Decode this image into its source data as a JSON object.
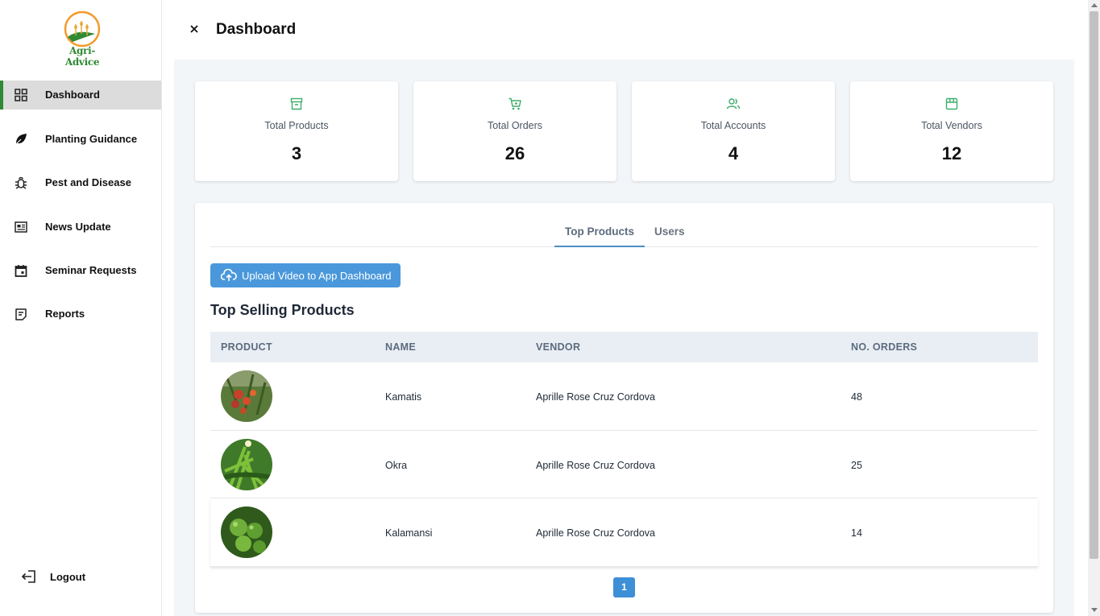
{
  "brand": {
    "name": "Agri-Advice"
  },
  "sidebar": {
    "items": [
      {
        "label": "Dashboard",
        "icon": "grid-icon"
      },
      {
        "label": "Planting Guidance",
        "icon": "leaf-icon"
      },
      {
        "label": "Pest and Disease",
        "icon": "bug-icon"
      },
      {
        "label": "News Update",
        "icon": "newspaper-icon"
      },
      {
        "label": "Seminar Requests",
        "icon": "calendar-icon"
      },
      {
        "label": "Reports",
        "icon": "report-icon"
      }
    ],
    "logout_label": "Logout"
  },
  "header": {
    "title": "Dashboard"
  },
  "stats": [
    {
      "label": "Total Products",
      "value": "3",
      "icon": "archive-icon"
    },
    {
      "label": "Total Orders",
      "value": "26",
      "icon": "cart-icon"
    },
    {
      "label": "Total Accounts",
      "value": "4",
      "icon": "users-icon"
    },
    {
      "label": "Total Vendors",
      "value": "12",
      "icon": "store-icon"
    }
  ],
  "tabs": [
    {
      "label": "Top Products",
      "active": true
    },
    {
      "label": "Users",
      "active": false
    }
  ],
  "upload_button": {
    "label": "Upload Video to App Dashboard"
  },
  "section_title": "Top Selling Products",
  "table": {
    "columns": [
      "PRODUCT",
      "NAME",
      "VENDOR",
      "NO. ORDERS"
    ],
    "rows": [
      {
        "name": "Kamatis",
        "vendor": "Aprille Rose Cruz Cordova",
        "orders": "48"
      },
      {
        "name": "Okra",
        "vendor": "Aprille Rose Cruz Cordova",
        "orders": "25"
      },
      {
        "name": "Kalamansi",
        "vendor": "Aprille Rose Cruz Cordova",
        "orders": "14"
      }
    ]
  },
  "pagination": {
    "current": "1"
  },
  "colors": {
    "accent_green": "#2f8a33",
    "icon_green": "#3cae6a",
    "button_blue": "#4a98db"
  }
}
